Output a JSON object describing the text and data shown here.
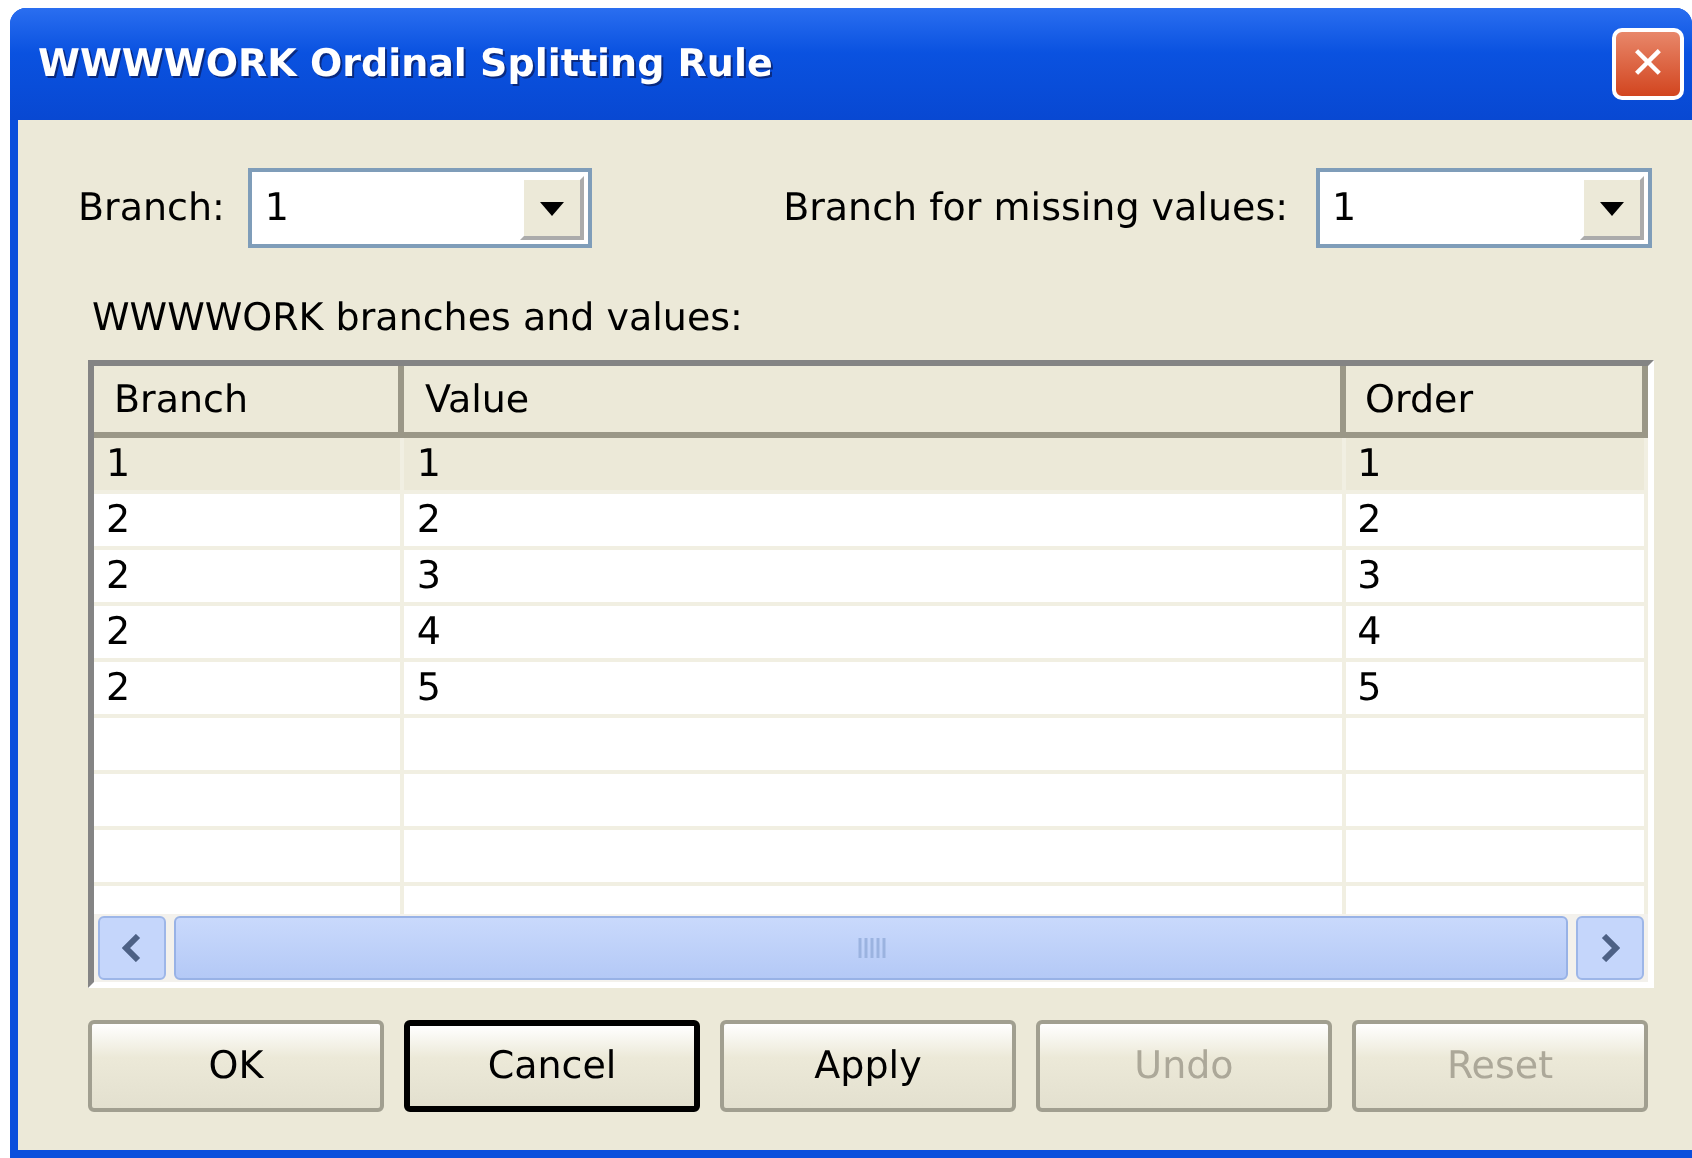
{
  "window": {
    "title": "WWWWORK Ordinal Splitting Rule",
    "close_glyph": "✕"
  },
  "branch": {
    "label": "Branch:",
    "value": "1"
  },
  "missing": {
    "label": "Branch for missing values:",
    "value": "1"
  },
  "table": {
    "caption": "WWWWORK branches and values:",
    "columns": [
      "Branch",
      "Value",
      "Order"
    ],
    "rows": [
      {
        "cells": [
          "1",
          "1",
          "1"
        ],
        "selected": true
      },
      {
        "cells": [
          "2",
          "2",
          "2"
        ],
        "selected": false
      },
      {
        "cells": [
          "2",
          "3",
          "3"
        ],
        "selected": false
      },
      {
        "cells": [
          "2",
          "4",
          "4"
        ],
        "selected": false
      },
      {
        "cells": [
          "2",
          "5",
          "5"
        ],
        "selected": false
      }
    ]
  },
  "buttons": [
    {
      "label": "OK",
      "disabled": false,
      "default": false
    },
    {
      "label": "Cancel",
      "disabled": false,
      "default": true
    },
    {
      "label": "Apply",
      "disabled": false,
      "default": false
    },
    {
      "label": "Undo",
      "disabled": true,
      "default": false
    },
    {
      "label": "Reset",
      "disabled": true,
      "default": false
    }
  ]
}
